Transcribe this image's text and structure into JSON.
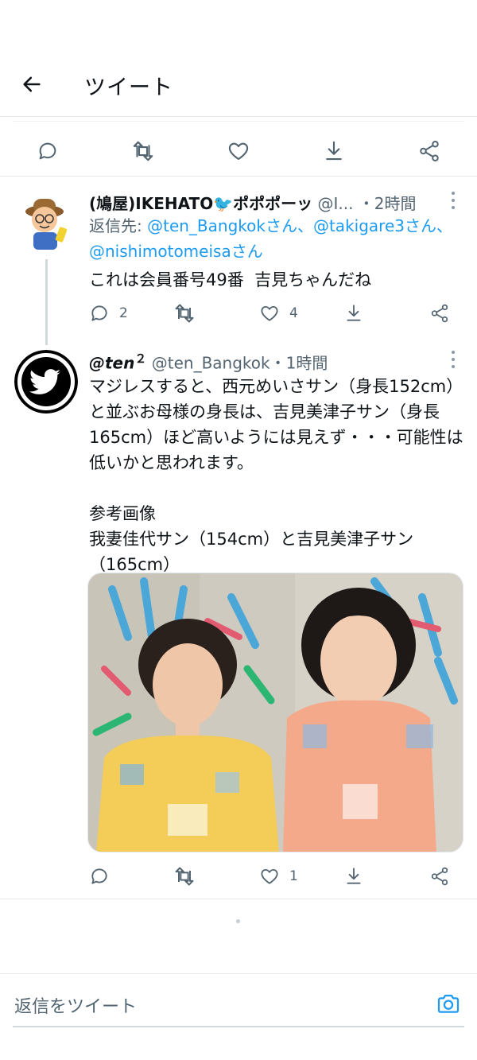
{
  "header": {
    "title": "ツイート"
  },
  "tweet1": {
    "display_name": "(鳩屋)IKEHATO",
    "name_emoji": "🐦",
    "name_suffix": "ポポポーッ",
    "handle": "@I...",
    "time": "・2時間",
    "reply_label": "返信先: ",
    "reply_user1": "@ten_Bangkokさん、",
    "reply_user2": "@takigare3さん、",
    "reply_user3": "@nishimotomeisaさん",
    "text": "これは会員番号49番  吉見ちゃんだね",
    "reply_count": "2",
    "retweet_count": "",
    "like_count": "4"
  },
  "tweet2": {
    "display_name": "@ten",
    "name_sup": "２",
    "handle": "@ten_Bangkok",
    "time": "・1時間",
    "text": "マジレスすると、西元めいさサン（身長152cm）と並ぶお母様の身長は、吉見美津子サン（身長165cm）ほど高いようには見えず・・・可能性は低いかと思われます。\n\n参考画像\n我妻佳代サン（154cm）と吉見美津子サン（165cm）",
    "reply_count": "",
    "retweet_count": "",
    "like_count": "1"
  },
  "reply_bar": {
    "placeholder": "返信をツイート"
  },
  "colors": {
    "accent": "#1d9bf0",
    "secondary_text": "#536471",
    "divider": "#e6e8ea"
  },
  "icons": [
    "back-arrow-icon",
    "reply-icon",
    "retweet-icon",
    "like-icon",
    "bookmark-download-icon",
    "share-icon",
    "more-icon",
    "camera-icon",
    "twitter-bird-icon"
  ]
}
